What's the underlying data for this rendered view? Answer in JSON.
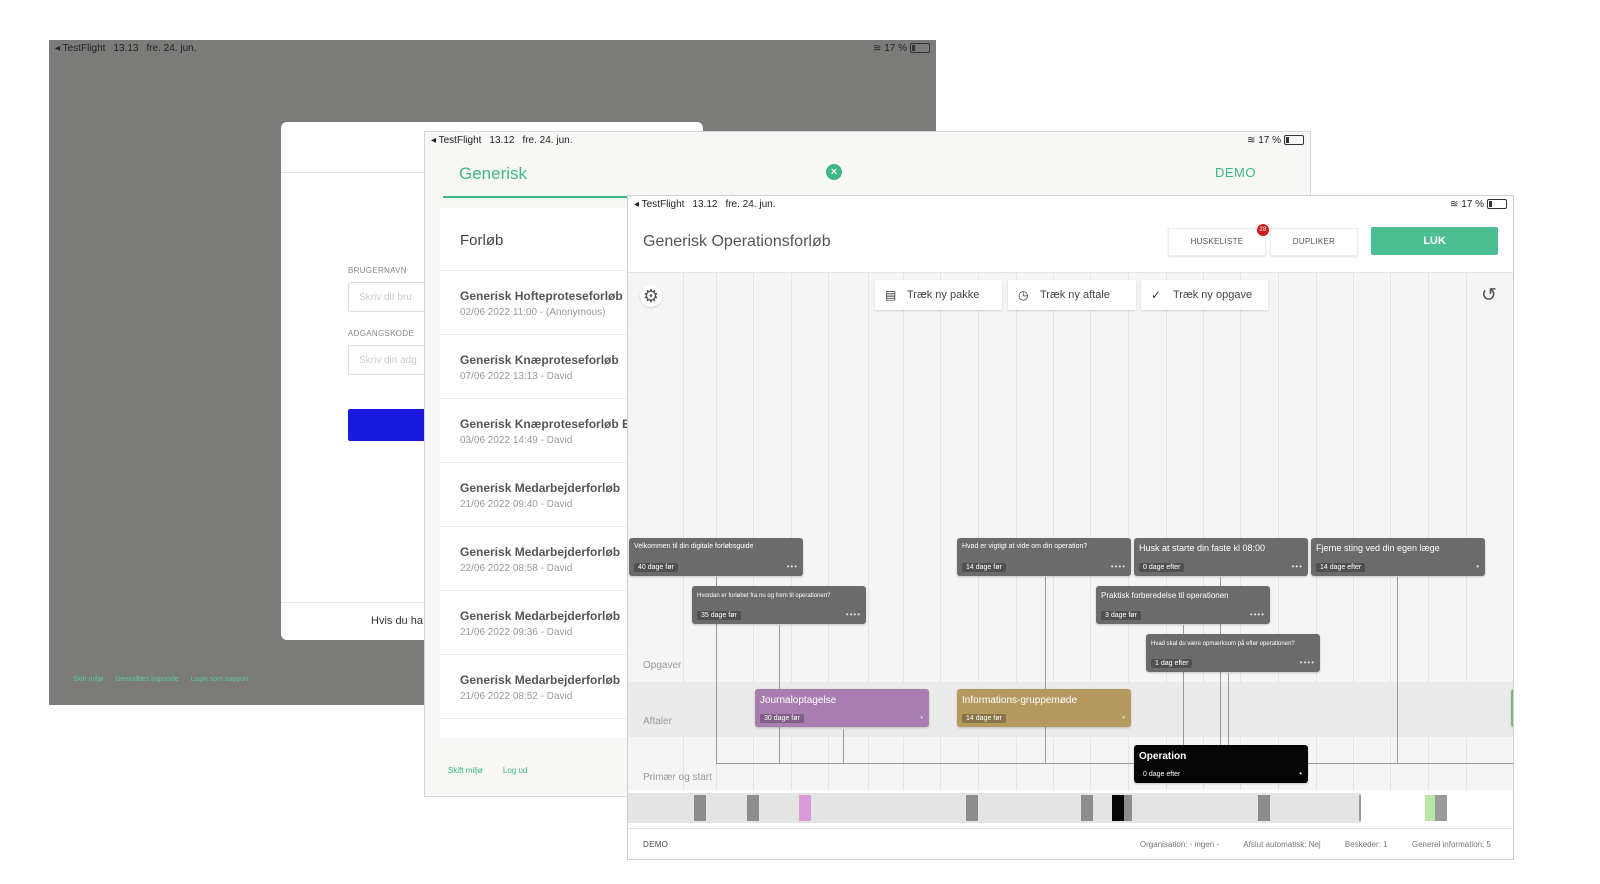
{
  "windows": {
    "login": {
      "status": {
        "app": "◂ TestFlight",
        "time": "13.13",
        "date": "fre. 24. jun.",
        "battery": "17 %"
      },
      "username_label": "BRUGERNAVN",
      "username_placeholder": "Skriv dit bru",
      "password_label": "ADGANGSKODE",
      "password_placeholder": "Skriv din adg",
      "footer_text": "Hvis du ha",
      "links": [
        "Skift miljø",
        "Genindlæs loginside",
        "Login som support"
      ]
    },
    "list": {
      "status": {
        "app": "◂ TestFlight",
        "time": "13.12",
        "date": "fre. 24. jun.",
        "battery": "17 %"
      },
      "title": "Generisk",
      "demo_label": "DEMO",
      "list_header": "Forløb",
      "items": [
        {
          "title": "Generisk Hofteproteseforløb",
          "subtitle": "02/06 2022 11:00 - (Anonymous)"
        },
        {
          "title": "Generisk Knæproteseforløb",
          "subtitle": "07/06 2022 13:13 - David"
        },
        {
          "title": "Generisk Knæproteseforløb E",
          "subtitle": "03/06 2022 14:49 - David"
        },
        {
          "title": "Generisk Medarbejderforløb",
          "subtitle": "21/06 2022 09:40 - David"
        },
        {
          "title": "Generisk Medarbejderforløb",
          "subtitle": "22/06 2022 08:58 - David"
        },
        {
          "title": "Generisk Medarbejderforløb",
          "subtitle": "21/06 2022 09:36 - David"
        },
        {
          "title": "Generisk Medarbejderforløb",
          "subtitle": "21/06 2022 08:52 - David"
        }
      ],
      "links": [
        "Skift miljø",
        "Log ud"
      ]
    },
    "editor": {
      "status": {
        "app": "◂ TestFlight",
        "time": "13.12",
        "date": "fre. 24. jun.",
        "battery": "17 %"
      },
      "title": "Generisk Operationsforløb",
      "buttons": {
        "huskeliste": "HUSKELISTE",
        "huskeliste_badge": "28",
        "dupliker": "DUPLIKER",
        "luk": "LUK"
      },
      "drag_buttons": [
        "Træk ny pakke",
        "Træk ny aftale",
        "Træk ny opgave"
      ],
      "lanes": {
        "opgaver": "Opgaver",
        "aftaler": "Aftaler",
        "primaer": "Primær og start"
      },
      "tasks": [
        {
          "title": "Velkommen til din digitale forløbsguide",
          "when": "40 dage før"
        },
        {
          "title": "Hvordan er forløbet fra nu og frem til operationen?",
          "when": "35 dage før"
        },
        {
          "title": "Hvad er vigtigt at vide om din operation?",
          "when": "14 dage før"
        },
        {
          "title": "Husk at starte din faste kl 08:00",
          "when": "0 dage efter"
        },
        {
          "title": "Fjerne sting ved din egen læge",
          "when": "14 dage efter"
        },
        {
          "title": "Praktisk forberedelse til operationen",
          "when": "3 dage før"
        },
        {
          "title": "Hvad skal du være opmærksom på efter operationen?",
          "when": "1 dag efter"
        }
      ],
      "appointments": [
        {
          "title": "Journaloptagelse",
          "when": "30 dage før"
        },
        {
          "title": "Informations-gruppemøde",
          "when": "14 dage før"
        }
      ],
      "primary": {
        "title": "Operation",
        "when": "0 dage efter"
      },
      "footer": {
        "env": "DEMO",
        "organisation": "Organisation:  - ingen -",
        "auto_close": "Afslut automatisk:  Nej",
        "messages": "Beskeder:  1",
        "general_info": "Generel information:  5"
      }
    }
  },
  "colors": {
    "accent": "#3eb884",
    "luk": "#4cbf92",
    "login_button": "#1a1adf",
    "badge": "#c81e1e",
    "appointment_purple": "#a87eb0",
    "appointment_gold": "#b59a60",
    "task_gray": "#6b6b6b"
  },
  "icons": {
    "gear": "gear-icon",
    "undo": "undo-icon",
    "package": "package-icon",
    "clock": "clock-icon",
    "check": "check-icon",
    "close": "close-circle-icon",
    "wifi": "wifi-icon",
    "battery": "battery-icon"
  }
}
